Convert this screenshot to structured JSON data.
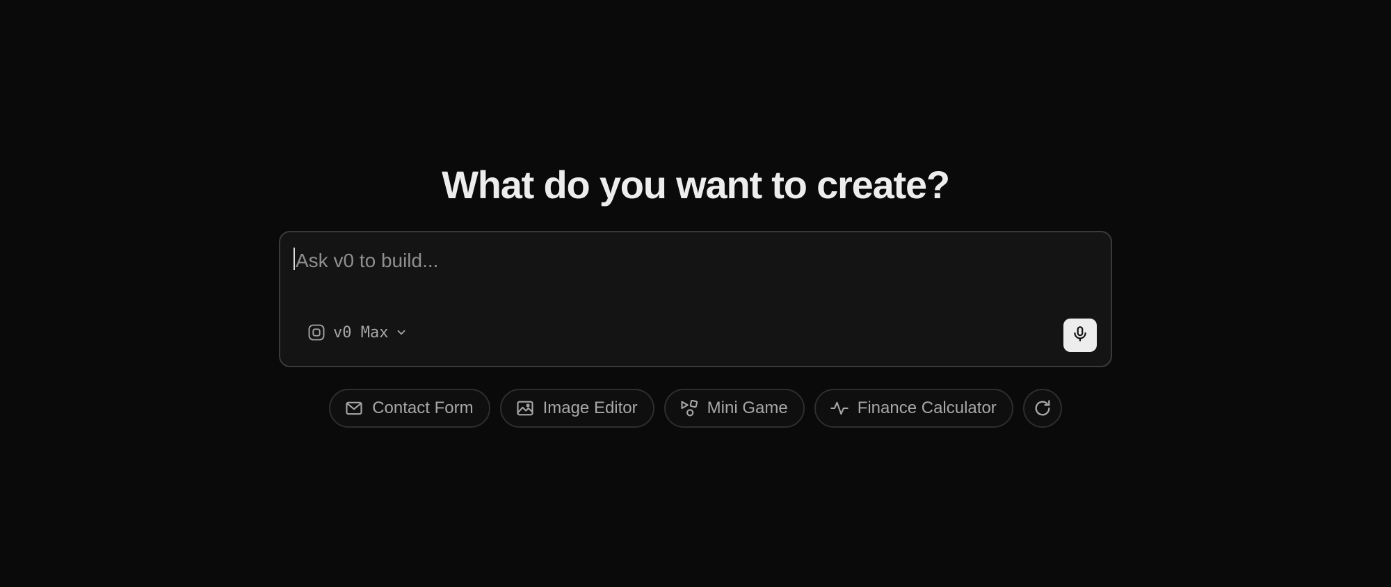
{
  "hero": {
    "title": "What do you want to create?"
  },
  "prompt": {
    "placeholder": "Ask v0 to build...",
    "value": "",
    "model": {
      "label": "v0 Max",
      "icon": "model-chip-icon",
      "chevron": "chevron-down-icon"
    },
    "mic_icon": "microphone-icon"
  },
  "suggestions": [
    {
      "label": "Contact Form",
      "icon": "mail-icon"
    },
    {
      "label": "Image Editor",
      "icon": "image-icon"
    },
    {
      "label": "Mini Game",
      "icon": "shapes-icon"
    },
    {
      "label": "Finance Calculator",
      "icon": "activity-icon"
    }
  ],
  "refresh_icon": "refresh-icon",
  "colors": {
    "background": "#0a0a0a",
    "input_background": "#141414",
    "border": "#3a3a3a",
    "text_primary": "#ededed",
    "text_muted": "#a8a8a8"
  }
}
